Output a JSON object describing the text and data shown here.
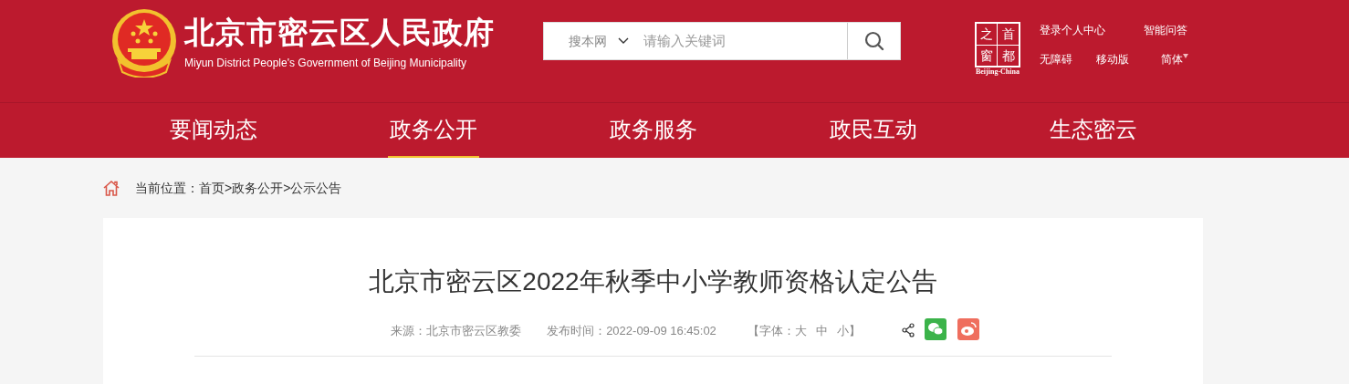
{
  "header": {
    "site_title": "北京市密云区人民政府",
    "site_subtitle": "Miyun District People's Government of Beijing Municipality",
    "search": {
      "scope": "搜本网",
      "placeholder": "请输入关键词"
    },
    "badge": {
      "chars": [
        "之",
        "首",
        "窗",
        "都"
      ],
      "caption": "Beijing-China"
    },
    "links": [
      {
        "label": "登录个人中心"
      },
      {
        "label": "智能问答"
      },
      {
        "label": "无障碍"
      },
      {
        "label": "移动版"
      },
      {
        "label": "简体",
        "dropdown": true
      }
    ]
  },
  "nav": [
    {
      "label": "要闻动态",
      "selected": false
    },
    {
      "label": "政务公开",
      "selected": true
    },
    {
      "label": "政务服务",
      "selected": false
    },
    {
      "label": "政民互动",
      "selected": false
    },
    {
      "label": "生态密云",
      "selected": false
    }
  ],
  "breadcrumb": {
    "prefix": "当前位置：",
    "items": [
      "首页",
      "政务公开",
      "公示公告"
    ],
    "separator": ">"
  },
  "article": {
    "title": "北京市密云区2022年秋季中小学教师资格认定公告",
    "source": "来源：北京市密云区教委",
    "published": "发布时间：2022-09-09 16:45:02",
    "font_size": {
      "open": "【字体：",
      "options": [
        "大",
        "中",
        "小"
      ],
      "close": "】"
    }
  }
}
